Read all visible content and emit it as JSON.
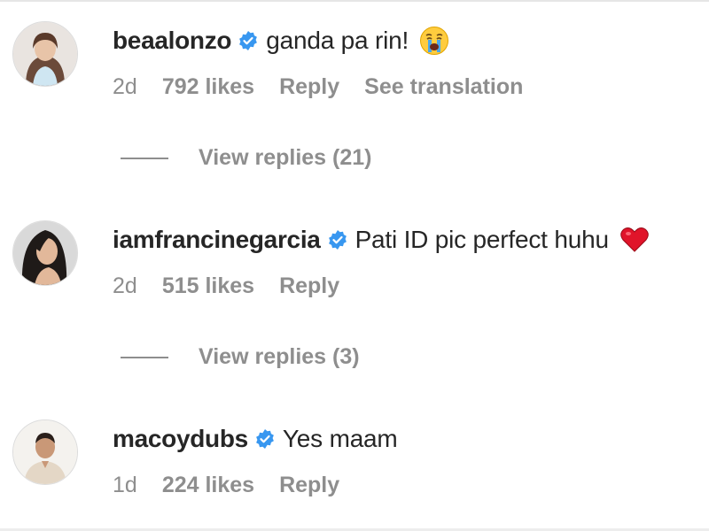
{
  "colors": {
    "text_primary": "#262626",
    "text_secondary": "#8e8e8e",
    "verified_blue": "#3897f0",
    "heart_red": "#e0142a"
  },
  "comments": [
    {
      "username": "beaalonzo",
      "verified": true,
      "text": "ganda pa rin!",
      "emoji": "crying-face-icon",
      "time": "2d",
      "likes": "792 likes",
      "reply": "Reply",
      "translation": "See translation",
      "view_replies": "View replies (21)"
    },
    {
      "username": "iamfrancinegarcia",
      "verified": true,
      "text": "Pati ID pic perfect huhu",
      "emoji": "red-heart-icon",
      "time": "2d",
      "likes": "515 likes",
      "reply": "Reply",
      "view_replies": "View replies (3)"
    },
    {
      "username": "macoydubs",
      "verified": true,
      "text": "Yes maam",
      "time": "1d",
      "likes": "224 likes",
      "reply": "Reply"
    }
  ]
}
